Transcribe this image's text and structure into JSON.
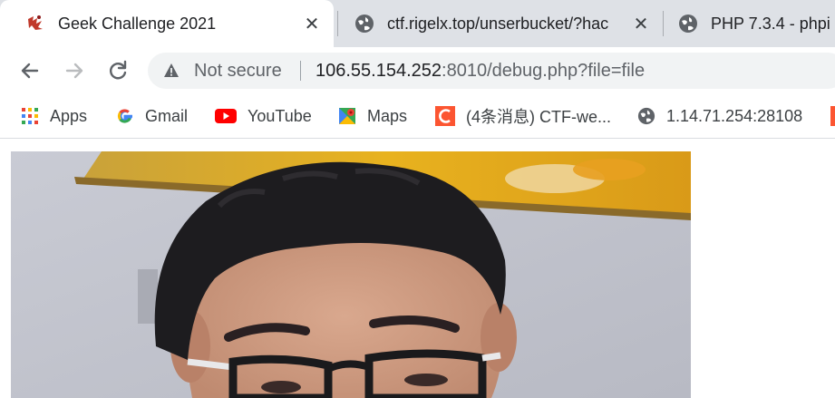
{
  "tabs": [
    {
      "title": "Geek Challenge 2021",
      "icon": "geek-logo-icon",
      "active": true
    },
    {
      "title": "ctf.rigelx.top/unserbucket/?hac",
      "icon": "globe-icon",
      "active": false
    },
    {
      "title": "PHP 7.3.4 - phpi",
      "icon": "globe-icon",
      "active": false
    }
  ],
  "toolbar": {
    "security_label": "Not secure",
    "url_host": "106.55.154.252",
    "url_rest": ":8010/debug.php?file=file"
  },
  "bookmarks": [
    {
      "label": "Apps",
      "icon": "apps-grid-icon"
    },
    {
      "label": "Gmail",
      "icon": "google-icon"
    },
    {
      "label": "YouTube",
      "icon": "youtube-icon"
    },
    {
      "label": "Maps",
      "icon": "maps-icon"
    },
    {
      "label": "(4条消息) CTF-we...",
      "icon": "csdn-icon"
    },
    {
      "label": "1.14.71.254:28108",
      "icon": "globe-icon"
    }
  ],
  "colors": {
    "tabstrip": "#dee1e6",
    "omnibox": "#f1f3f4",
    "youtube_red": "#ff0000",
    "csdn_orange": "#fc5531"
  }
}
